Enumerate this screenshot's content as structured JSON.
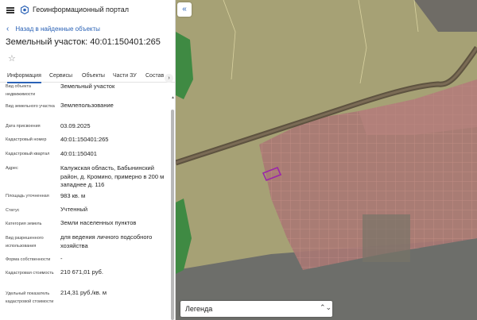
{
  "header": {
    "title": "Геоинформационный портал",
    "menu_icon": "hamburger-icon",
    "logo_icon": "portal-logo-icon"
  },
  "back_link": {
    "label": "Назад в найденные объекты",
    "icon": "chevron-left-icon"
  },
  "parcel": {
    "title": "Земельный участок: 40:01:150401:265",
    "favorite_icon": "star-icon"
  },
  "tabs": [
    {
      "label": "Информация",
      "active": true
    },
    {
      "label": "Сервисы",
      "active": false
    },
    {
      "label": "Объекты",
      "active": false
    },
    {
      "label": "Части ЗУ",
      "active": false
    },
    {
      "label": "Состав",
      "active": false
    }
  ],
  "tabs_next_icon": "chevron-right-icon",
  "attributes": [
    {
      "label": "Вид объекта недвижимости",
      "value": "Земельный участок"
    },
    {
      "label": "Вид земельного участка",
      "value": "Землепользование"
    },
    {
      "label": "Дата присвоения",
      "value": "03.09.2025"
    },
    {
      "label": "Кадастровый номер",
      "value": "40:01:150401:265"
    },
    {
      "label": "Кадастровый квартал",
      "value": "40:01:150401"
    },
    {
      "label": "Адрес",
      "value": "Калужская область, Бабынинский район, д. Кромино, примерно в 200 м западнее д. 116"
    },
    {
      "label": "Площадь уточненная",
      "value": "983 кв. м"
    },
    {
      "label": "Статус",
      "value": "Учтенный"
    },
    {
      "label": "Категория земель",
      "value": "Земли населенных пунктов"
    },
    {
      "label": "Вид разрешенного использования",
      "value": "для ведения личного подсобного хозяйства"
    },
    {
      "label": "Форма собственности",
      "value": "-"
    },
    {
      "label": "Кадастровая стоимость",
      "value": "210 671,01 руб."
    },
    {
      "label": "Удельный показатель кадастровой стоимости",
      "value": "214,31 руб./кв. м"
    }
  ],
  "map": {
    "collapse_icon": "double-chevron-left-icon",
    "legend_label": "Легенда",
    "legend_icon": "chevron-updown-icon",
    "colors": {
      "background": "#a6a175",
      "parcels": "#b57a76",
      "road": "#5e5340",
      "green": "#3f8a43",
      "selected": "#9b27a8"
    }
  }
}
